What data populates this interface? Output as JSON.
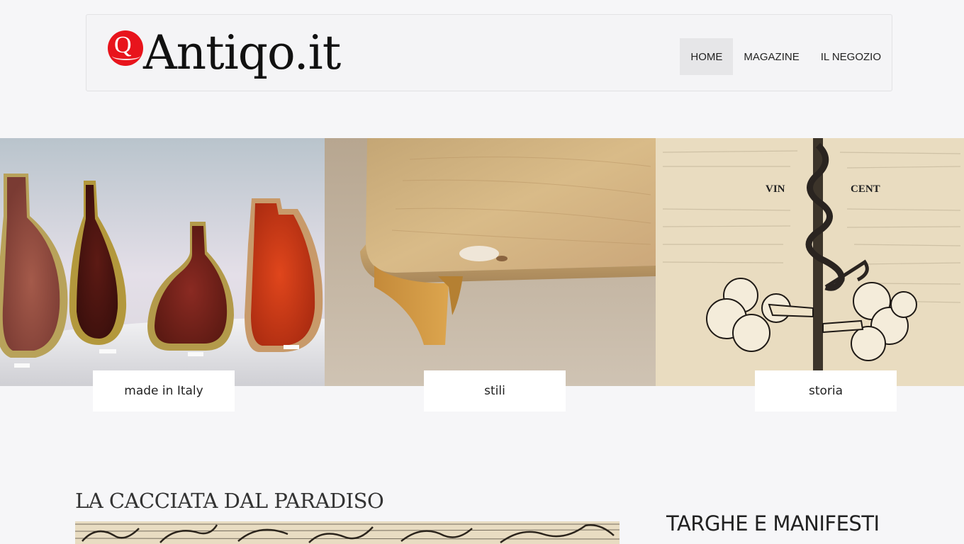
{
  "header": {
    "logo_text": "Antiqo.it",
    "logo_mark": "Q",
    "nav": [
      {
        "label": "HOME",
        "active": true
      },
      {
        "label": "MAGAZINE",
        "active": false
      },
      {
        "label": "IL NEGOZIO",
        "active": false
      }
    ]
  },
  "tiles": [
    {
      "label": "made in Italy",
      "image": "glass-vases-photo"
    },
    {
      "label": "stili",
      "image": "wooden-table-photo"
    },
    {
      "label": "storia",
      "image": "serpent-engraving-photo"
    }
  ],
  "article": {
    "title": "LA CACCIATA DAL PARADISO",
    "image": "engraving-photo"
  },
  "sidebar": {
    "title": "TARGHE E MANIFESTI"
  },
  "colors": {
    "brand_red": "#e8141c",
    "background": "#f6f6f8",
    "nav_active_bg": "#e6e6e8"
  }
}
